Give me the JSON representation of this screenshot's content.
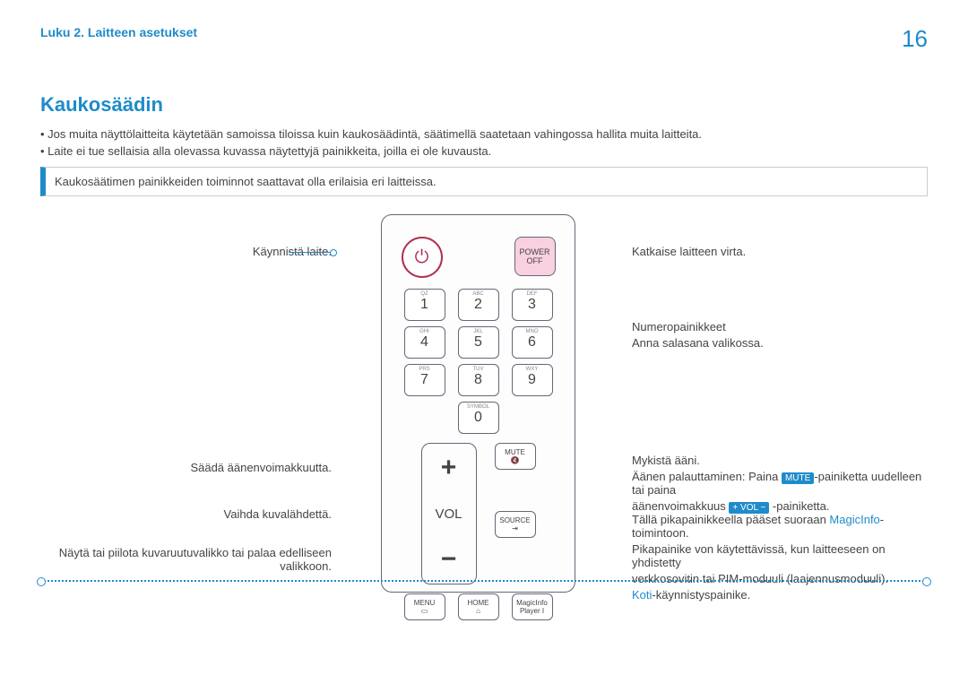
{
  "header": {
    "chapter": "Luku 2. Laitteen asetukset",
    "page": "16"
  },
  "title": "Kaukosäädin",
  "bullets": {
    "b1": "Jos muita näyttölaitteita käytetään samoissa tiloissa kuin kaukosäädintä, säätimellä saatetaan vahingossa hallita muita laitteita.",
    "b2": "Laite ei tue sellaisia alla olevassa kuvassa näytettyjä painikkeita, joilla ei ole kuvausta."
  },
  "note": "Kaukosäätimen painikkeiden toiminnot saattavat olla erilaisia eri laitteissa.",
  "remote": {
    "poweroff": {
      "l1": "POWER",
      "l2": "OFF"
    },
    "k1s": "QZ",
    "k1": "1",
    "k2s": "ABC",
    "k2": "2",
    "k3s": "DEF",
    "k3": "3",
    "k4s": "GHI",
    "k4": "4",
    "k5s": "JKL",
    "k5": "5",
    "k6s": "MNO",
    "k6": "6",
    "k7s": "PRS",
    "k7": "7",
    "k8s": "TUV",
    "k8": "8",
    "k9s": "WXY",
    "k9": "9",
    "k0s": "SYMBOL",
    "k0": "0",
    "vol": {
      "plus": "+",
      "label": "VOL",
      "minus": "−"
    },
    "mute": "MUTE",
    "source": "SOURCE",
    "menu": "MENU",
    "home": "HOME",
    "magicinfo": {
      "l1": "MagicInfo",
      "l2": "Player I"
    }
  },
  "callouts": {
    "left": {
      "power": "Käynnistä laite.",
      "vol": "Säädä äänenvoimakkuutta.",
      "source": "Vaihda kuvalähdettä.",
      "menu": "Näytä tai piilota kuvaruutuvalikko tai palaa edelliseen valikkoon."
    },
    "right": {
      "poweroff": "Katkaise laitteen virta.",
      "num1": "Numeropainikkeet",
      "num2": "Anna salasana valikossa.",
      "mute1": "Mykistä ääni.",
      "mute2a": "Äänen palauttaminen: Paina ",
      "mute2b": "MUTE",
      "mute2c": "-painiketta uudelleen tai paina",
      "mute3a": "äänenvoimakkuus ",
      "mute3b": "+ VOL −",
      "mute3c": " -painiketta.",
      "magic1a": "Tällä pikapainikkeella pääset suoraan ",
      "magic1b": "MagicInfo",
      "magic1c": "-toimintoon.",
      "magic2": "Pikapainike von käytettävissä, kun laitteeseen on yhdistetty",
      "magic3": "verkkosovitin tai PIM-moduuli (laajennusmoduuli).",
      "home1": "Koti",
      "home2": "-käynnistyspainike."
    }
  }
}
